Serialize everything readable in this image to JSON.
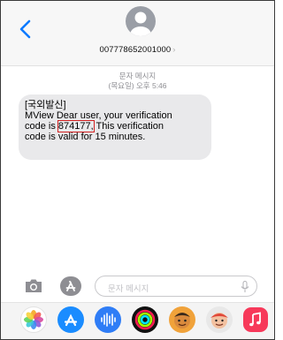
{
  "header": {
    "contact_number": "007778652001000",
    "contact_chevron": "›"
  },
  "thread": {
    "meta_label": "문자 메시지",
    "meta_time": "(목요일) 오후 5:46",
    "message": {
      "line1": "[국외발신]",
      "line2": "MView Dear user, your verification",
      "line3_prefix": "code is ",
      "code": "874177,",
      "line3_suffix": " This verification",
      "line4": "code is valid for 15 minutes."
    }
  },
  "composer": {
    "placeholder": "문자 메시지"
  },
  "icons": {
    "back": "chevron-left-icon",
    "avatar": "person-icon",
    "camera": "camera-icon",
    "apps": "app-store-icon",
    "mic": "microphone-icon"
  },
  "app_drawer": {
    "apps": [
      "photos",
      "app-store",
      "audio",
      "activity",
      "memoji",
      "memoji-stickers",
      "music"
    ]
  },
  "colors": {
    "accent": "#0a7aff",
    "bubble": "#e9e9eb",
    "highlight": "#d22222"
  }
}
